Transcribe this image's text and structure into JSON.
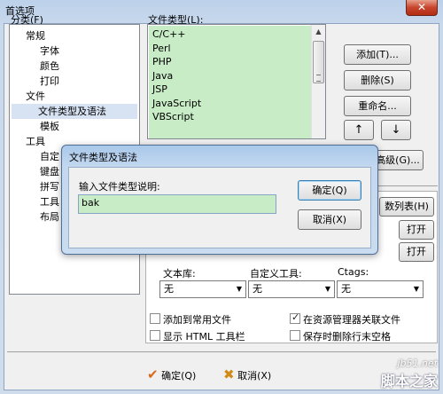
{
  "window": {
    "title": "首选项",
    "close_label": "✕"
  },
  "categories": {
    "label": "分类(F)",
    "items": [
      "常规",
      "字体",
      "颜色",
      "打印",
      "文件",
      "文件类型及语法",
      "模板",
      "工具",
      "自定",
      "键盘",
      "拼写",
      "工具",
      "布局"
    ],
    "selected": "文件类型及语法"
  },
  "file_types": {
    "label": "文件类型(L):",
    "items": [
      "C/C++",
      "Perl",
      "PHP",
      "Java",
      "JSP",
      "JavaScript",
      "VBScript"
    ]
  },
  "side_buttons": {
    "add": "添加(T)...",
    "delete": "删除(S)",
    "rename": "重命名...",
    "up": "↑",
    "down": "↓",
    "advanced": "高级(G)...",
    "func_list": "数列表(H)",
    "open1": "打开",
    "open2": "打开"
  },
  "options": {
    "library_label": "文本库:",
    "custom_tool_label": "自定义工具:",
    "ctags_label": "Ctags:",
    "library_value": "无",
    "custom_tool_value": "无",
    "ctags_value": "无",
    "add_common": "添加到常用文件",
    "assoc_explorer": "在资源管理器关联文件",
    "show_html": "显示 HTML 工具栏",
    "trim_spaces": "保存时删除行末空格",
    "assoc_checked": true
  },
  "footer": {
    "ok": "确定(Q)",
    "cancel": "取消(X)"
  },
  "dialog": {
    "title": "文件类型及语法",
    "prompt": "输入文件类型说明:",
    "input_value": "bak",
    "ok": "确定(Q)",
    "cancel": "取消(X)"
  },
  "watermark": {
    "site": "jb51.net",
    "brand": "脚本之家"
  }
}
